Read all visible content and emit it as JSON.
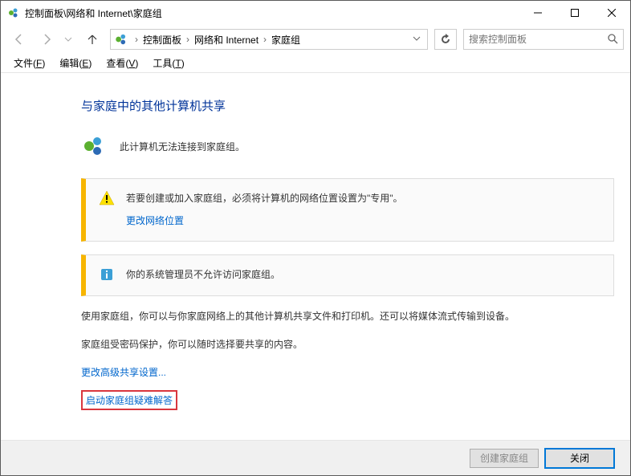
{
  "window": {
    "title": "控制面板\\网络和 Internet\\家庭组"
  },
  "breadcrumb": {
    "items": [
      "控制面板",
      "网络和 Internet",
      "家庭组"
    ]
  },
  "search": {
    "placeholder": "搜索控制面板"
  },
  "menubar": {
    "file": "文件(F)",
    "edit": "编辑(E)",
    "view": "查看(V)",
    "tools": "工具(T)"
  },
  "page": {
    "heading": "与家庭中的其他计算机共享",
    "status_text": "此计算机无法连接到家庭组。",
    "notice1": {
      "text": "若要创建或加入家庭组，必须将计算机的网络位置设置为\"专用\"。",
      "link": "更改网络位置"
    },
    "notice2": {
      "text": "你的系统管理员不允许访问家庭组。"
    },
    "body1": "使用家庭组，你可以与你家庭网络上的其他计算机共享文件和打印机。还可以将媒体流式传输到设备。",
    "body2": "家庭组受密码保护，你可以随时选择要共享的内容。",
    "adv_link": "更改高级共享设置...",
    "troubleshoot_link": "启动家庭组疑难解答"
  },
  "footer": {
    "create_btn": "创建家庭组",
    "close_btn": "关闭"
  }
}
